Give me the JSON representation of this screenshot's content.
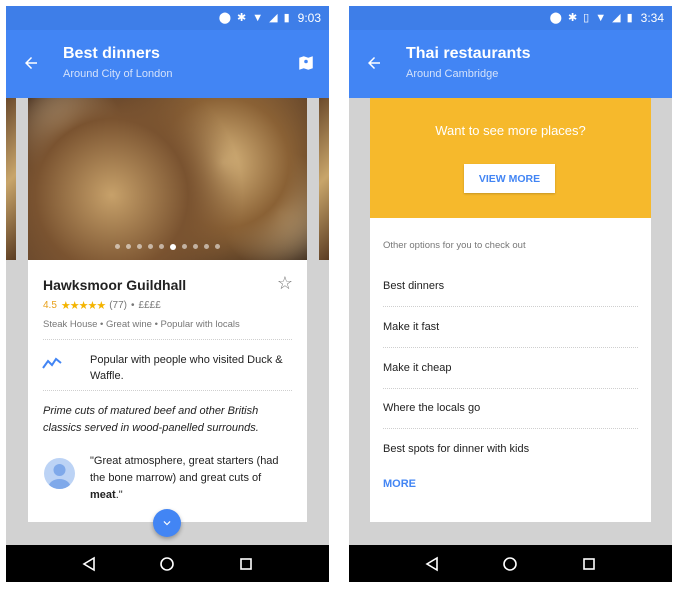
{
  "left_phone": {
    "status_bar": {
      "time": "9:03"
    },
    "app_bar": {
      "title": "Best dinners",
      "subtitle": "Around City of London"
    },
    "carousel": {
      "dot_count": 10,
      "active_dot": 5
    },
    "place": {
      "name": "Hawksmoor Guildhall",
      "rating": "4.5",
      "stars": "★★★★★",
      "review_count": "(77)",
      "separator": "•",
      "price": "££££",
      "tags": "Steak House  •  Great wine  •  Popular with locals",
      "popularity_text": "Popular with people who visited Duck & Waffle.",
      "description": "Prime cuts of matured beef and other British classics served in wood-panelled surrounds.",
      "review_plain": "\"Great atmosphere, great starters (had the bone marrow) and great cuts of ",
      "review_bold": "meat",
      "review_end": ".\""
    }
  },
  "right_phone": {
    "status_bar": {
      "time": "3:34"
    },
    "app_bar": {
      "title": "Thai restaurants",
      "subtitle": "Around Cambridge"
    },
    "promo": {
      "text": "Want to see more places?",
      "button_label": "VIEW MORE"
    },
    "section_label": "Other options for you to check out",
    "options": [
      "Best dinners",
      "Make it fast",
      "Make it cheap",
      "Where the locals go",
      "Best spots for dinner with kids"
    ],
    "more_label": "MORE"
  },
  "colors": {
    "primary": "#4285f4",
    "status_bar": "#3e7ee8",
    "promo": "#f6b92c",
    "star": "#f4b400"
  }
}
